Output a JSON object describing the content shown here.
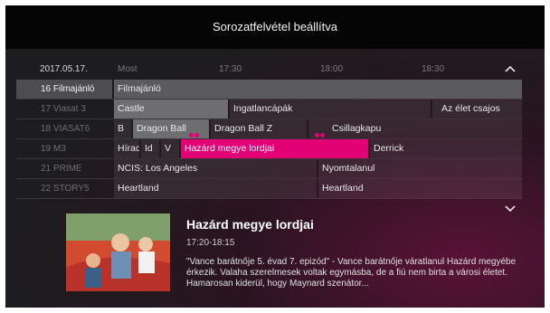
{
  "banner": {
    "title": "Sorozatfelvétel beállítva"
  },
  "timebar": {
    "date": "2017.05.17.",
    "times": [
      "Most",
      "17:30",
      "18:00",
      "18:30"
    ]
  },
  "channels": [
    {
      "name": "16 Filmajánló",
      "programs": [
        "Filmajánló"
      ]
    },
    {
      "name": "17 Viasat 3",
      "programs": [
        "Castle",
        "Ingatlancápák",
        "Az élet csajos"
      ]
    },
    {
      "name": "18 VIASAT6",
      "programs": [
        "B",
        "Dragon Ball",
        "Dragon Ball Z",
        "Csillagkapu"
      ]
    },
    {
      "name": "19 M3",
      "programs": [
        "Hírad",
        "Id",
        "V",
        "Hazárd megye lordjai",
        "Derrick"
      ]
    },
    {
      "name": "21 PRIME",
      "programs": [
        "NCIS: Los Angeles",
        "Nyomtalanul"
      ]
    },
    {
      "name": "22 STORY5",
      "programs": [
        "Heartland",
        "Heartland"
      ]
    }
  ],
  "detail": {
    "title": "Hazárd megye lordjai",
    "time": "17:20-18:15",
    "description": "\"Vance barátnője 5. évad 7. epizód\" - Vance barátnője váratlanul Hazárd megyébe érkezik. Valaha szerelmesek voltak egymásba, de a fiú nem birta a városi életet. Hamarosan kiderül, hogy Maynard szenátor..."
  },
  "icons": {
    "scroll_up": "chevron-up-icon",
    "scroll_down": "chevron-down-icon",
    "record": "record-icon"
  },
  "colors": {
    "accent": "#e20074",
    "banner": "#050505"
  }
}
